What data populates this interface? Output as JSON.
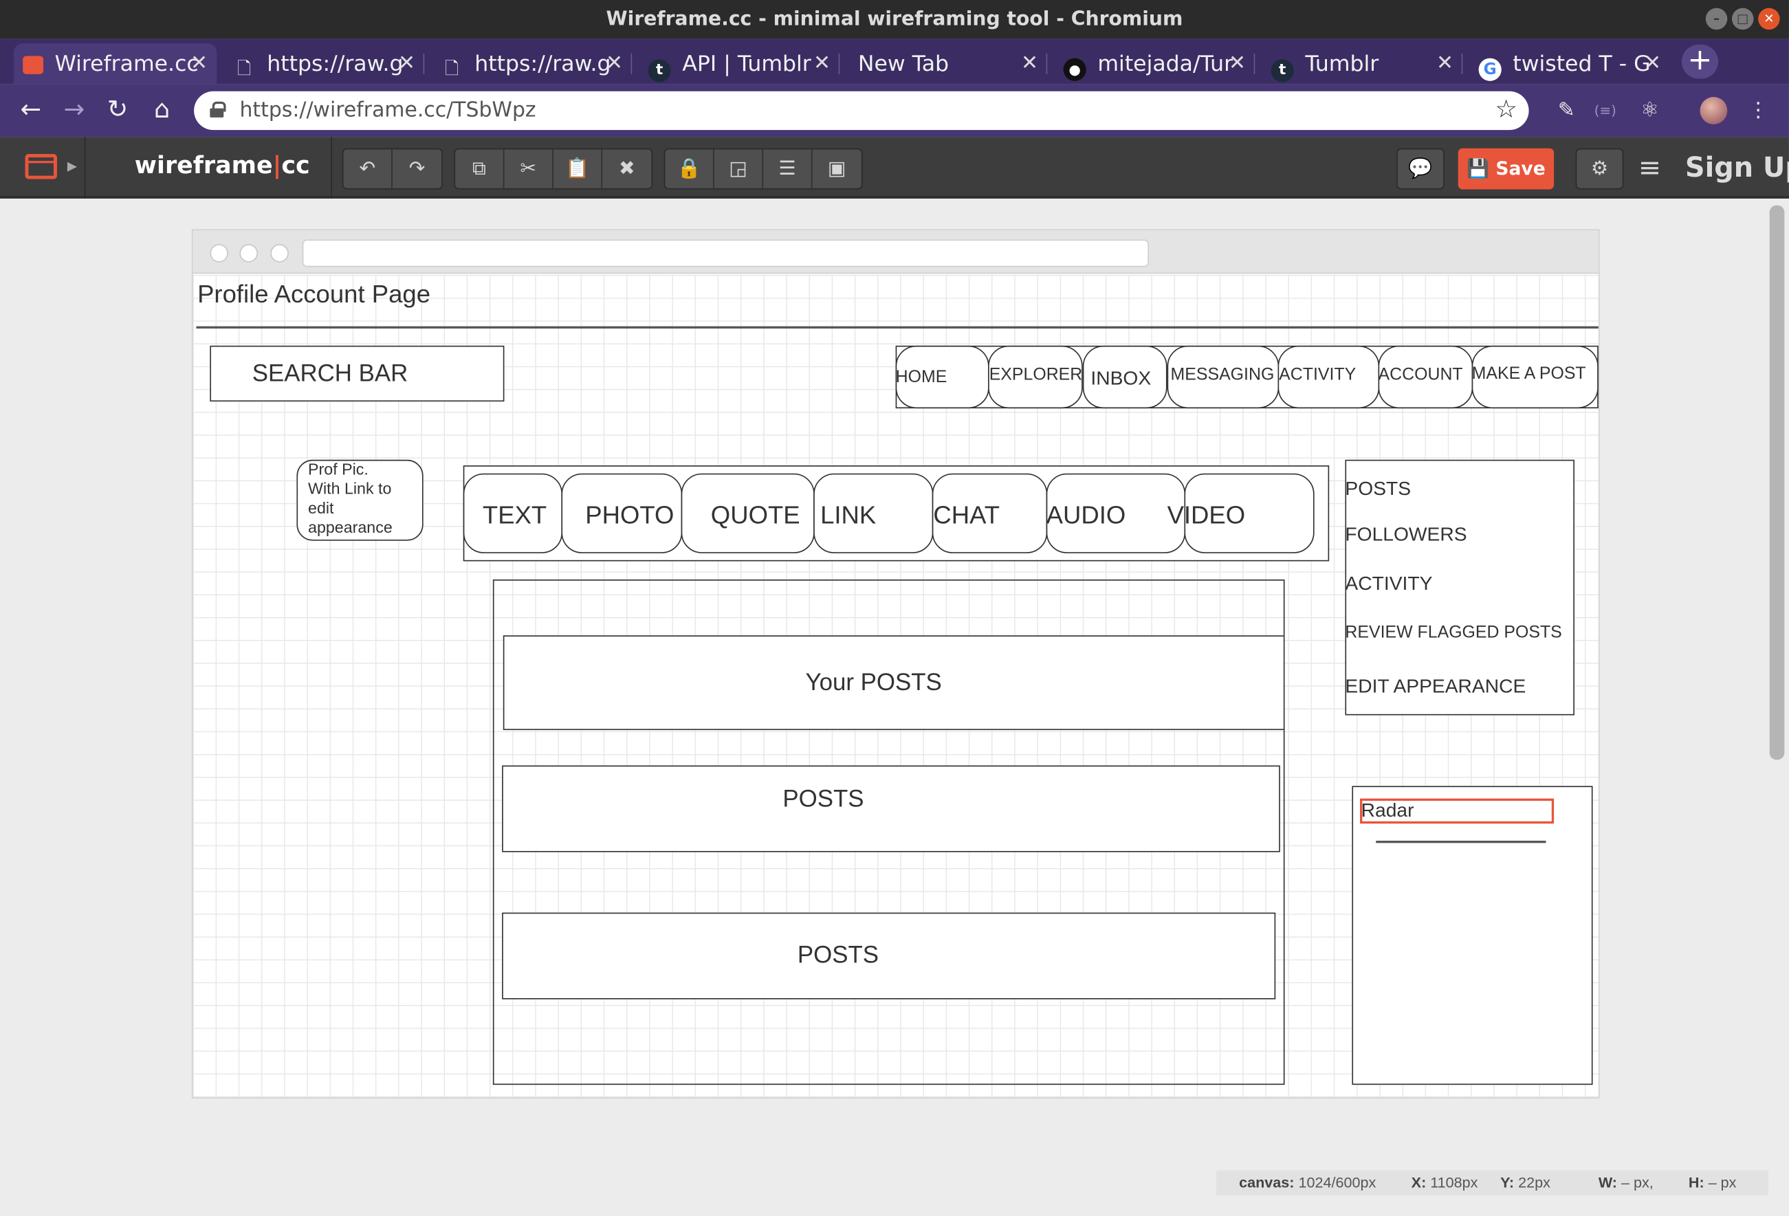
{
  "window": {
    "title": "Wireframe.cc - minimal wireframing tool - Chromium"
  },
  "tabs": [
    {
      "label": "Wireframe.cc",
      "icon": "wireframe-icon"
    },
    {
      "label": "https://raw.g",
      "icon": "file-icon"
    },
    {
      "label": "https://raw.g",
      "icon": "file-icon"
    },
    {
      "label": "API | Tumblr",
      "icon": "tumblr-icon"
    },
    {
      "label": "New Tab",
      "icon": ""
    },
    {
      "label": "mitejada/Tur",
      "icon": "github-icon"
    },
    {
      "label": "Tumblr",
      "icon": "tumblr-icon"
    },
    {
      "label": "twisted T - G",
      "icon": "google-icon"
    }
  ],
  "address": {
    "url": "https://wireframe.cc/TSbWpz"
  },
  "app": {
    "logo_left": "wireframe",
    "logo_sep": "|",
    "logo_right": "cc",
    "save_label": "Save",
    "signup_label": "Sign Up",
    "accent": "#e8553a"
  },
  "wireframe": {
    "page_title": "Profile Account Page",
    "search_bar": "SEARCH BAR",
    "nav": [
      "HOME",
      "EXPLORER",
      "INBOX",
      "MESSAGING",
      "ACTIVITY",
      "ACCOUNT",
      "MAKE A POST"
    ],
    "prof_pic": [
      "Prof Pic.",
      "With Link to",
      "edit",
      "appearance"
    ],
    "post_types": [
      "TEXT",
      "PHOTO",
      "QUOTE",
      "LINK",
      "CHAT",
      "AUDIO",
      "VIDEO"
    ],
    "posts": [
      "Your POSTS",
      "POSTS",
      "POSTS"
    ],
    "side_menu": [
      "POSTS",
      "FOLLOWERS",
      "ACTIVITY",
      "REVIEW FLAGGED POSTS",
      "EDIT APPEARANCE"
    ],
    "radar": "Radar"
  },
  "status": {
    "canvas_label": "canvas:",
    "canvas_value": "1024/600px",
    "x_label": "X:",
    "x_value": "1108px",
    "y_label": "Y:",
    "y_value": "22px",
    "w_label": "W:",
    "w_value": "– px,",
    "h_label": "H:",
    "h_value": "– px"
  }
}
